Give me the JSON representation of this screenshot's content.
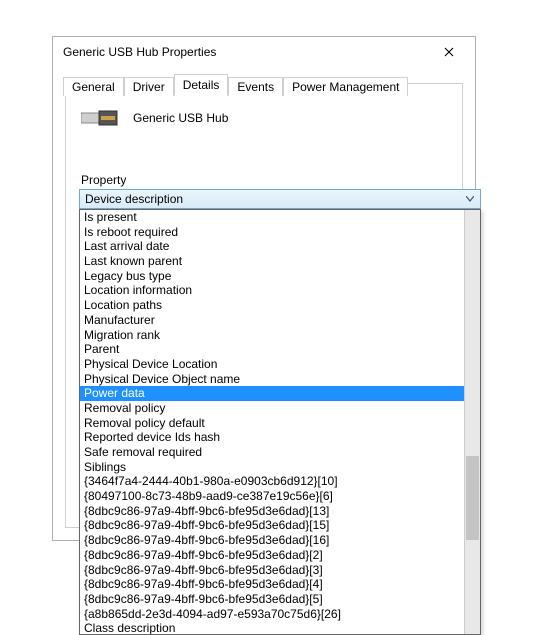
{
  "window": {
    "title": "Generic USB Hub Properties"
  },
  "tabs": {
    "general": "General",
    "driver": "Driver",
    "details": "Details",
    "events": "Events",
    "power": "Power Management",
    "active": "details"
  },
  "device": {
    "name": "Generic USB Hub"
  },
  "property": {
    "label": "Property",
    "selected": "Device description"
  },
  "dropdown": {
    "highlightIndex": 12,
    "items": [
      "Is present",
      "Is reboot required",
      "Last arrival date",
      "Last known parent",
      "Legacy bus type",
      "Location information",
      "Location paths",
      "Manufacturer",
      "Migration rank",
      "Parent",
      "Physical Device Location",
      "Physical Device Object name",
      "Power data",
      "Removal policy",
      "Removal policy default",
      "Reported device Ids hash",
      "Safe removal required",
      "Siblings",
      "{3464f7a4-2444-40b1-980a-e0903cb6d912}[10]",
      "{80497100-8c73-48b9-aad9-ce387e19c56e}[6]",
      "{8dbc9c86-97a9-4bff-9bc6-bfe95d3e6dad}[13]",
      "{8dbc9c86-97a9-4bff-9bc6-bfe95d3e6dad}[15]",
      "{8dbc9c86-97a9-4bff-9bc6-bfe95d3e6dad}[16]",
      "{8dbc9c86-97a9-4bff-9bc6-bfe95d3e6dad}[2]",
      "{8dbc9c86-97a9-4bff-9bc6-bfe95d3e6dad}[3]",
      "{8dbc9c86-97a9-4bff-9bc6-bfe95d3e6dad}[4]",
      "{8dbc9c86-97a9-4bff-9bc6-bfe95d3e6dad}[5]",
      "{a8b865dd-2e3d-4094-ad97-e593a70c75d6}[26]",
      "Class description"
    ]
  }
}
